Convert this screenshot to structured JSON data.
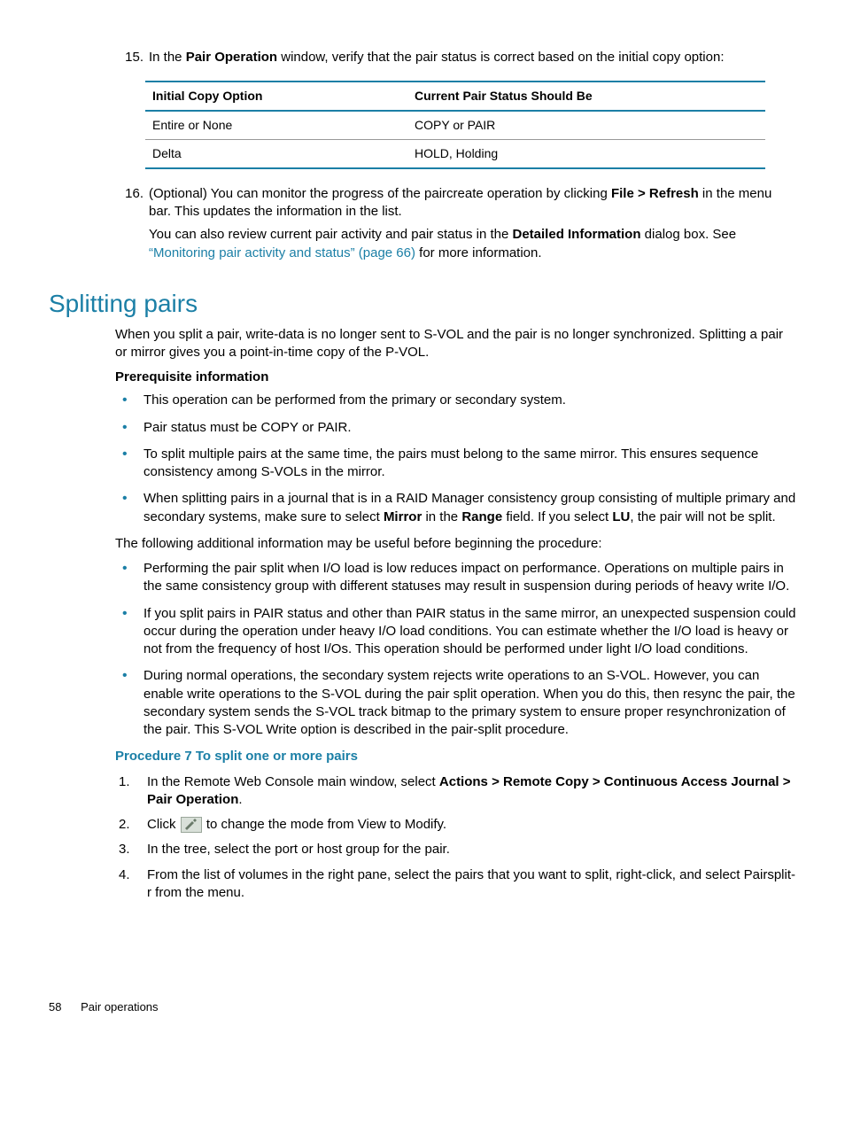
{
  "steps_top": {
    "s15": {
      "num": "15.",
      "para_a_pre": "In the ",
      "para_a_bold": "Pair Operation",
      "para_a_post": " window, verify that the pair status is correct based on the initial copy option:"
    },
    "s16": {
      "num": "16.",
      "p1_pre": "(Optional) You can monitor the progress of the paircreate operation by clicking ",
      "p1_bold": "File > Refresh",
      "p1_post": " in the menu bar. This updates the information in the list.",
      "p2_pre": "You can also review current pair activity and pair status in the ",
      "p2_bold": "Detailed Information",
      "p2_mid": " dialog box. See ",
      "p2_link": "“Monitoring pair activity and status” (page 66)",
      "p2_post": " for more information."
    }
  },
  "table": {
    "h1": "Initial Copy Option",
    "h2": "Current Pair Status Should Be",
    "r1c1": "Entire or None",
    "r1c2": "COPY or PAIR",
    "r2c1": "Delta",
    "r2c2": "HOLD, Holding"
  },
  "section_title": "Splitting pairs",
  "intro": "When you split a pair, write-data is no longer sent to S-VOL and the pair is no longer synchronized. Splitting a pair or mirror gives you a point-in-time copy of the P-VOL.",
  "prereq_label": "Prerequisite information",
  "prereq": {
    "b1": "This operation can be performed from the primary or secondary system.",
    "b2": "Pair status must be COPY or PAIR.",
    "b3": "To split multiple pairs at the same time, the pairs must belong to the same mirror. This ensures sequence consistency among S-VOLs in the mirror.",
    "b4_pre": "When splitting pairs in a journal that is in a RAID Manager consistency group consisting of multiple primary and secondary systems, make sure to select ",
    "b4_b1": "Mirror",
    "b4_mid": " in the ",
    "b4_b2": "Range",
    "b4_mid2": " field. If you select ",
    "b4_b3": "LU",
    "b4_post": ", the pair will not be split."
  },
  "addl_intro": "The following additional information may be useful before beginning the procedure:",
  "addl": {
    "b1": "Performing the pair split when I/O load is low reduces impact on performance. Operations on multiple pairs in the same consistency group with different statuses may result in suspension during periods of heavy write I/O.",
    "b2": "If you split pairs in PAIR status and other than PAIR status in the same mirror, an unexpected suspension could occur during the operation under heavy I/O load conditions. You can estimate whether the I/O load is heavy or not from the frequency of host I/Os. This operation should be performed under light I/O load conditions.",
    "b3": "During normal operations, the secondary system rejects write operations to an S-VOL. However, you can enable write operations to the S-VOL during the pair split operation. When you do this, then resync the pair, the secondary system sends the S-VOL track bitmap to the primary system to ensure proper resynchronization of the pair. This S-VOL Write option is described in the pair-split procedure."
  },
  "proc_title": "Procedure 7 To split one or more pairs",
  "proc": {
    "s1": {
      "n": "1.",
      "pre": "In the Remote Web Console main window, select ",
      "b": "Actions > Remote Copy > Continuous Access Journal > Pair Operation",
      "post": "."
    },
    "s2": {
      "n": "2.",
      "pre": "Click ",
      "post": " to change the mode from View to Modify."
    },
    "s3": {
      "n": "3.",
      "t": "In the tree, select the port or host group for the pair."
    },
    "s4": {
      "n": "4.",
      "t": "From the list of volumes in the right pane, select the pairs that you want to split, right-click, and select Pairsplit-r from the menu."
    }
  },
  "footer": {
    "page": "58",
    "section": "Pair operations"
  }
}
